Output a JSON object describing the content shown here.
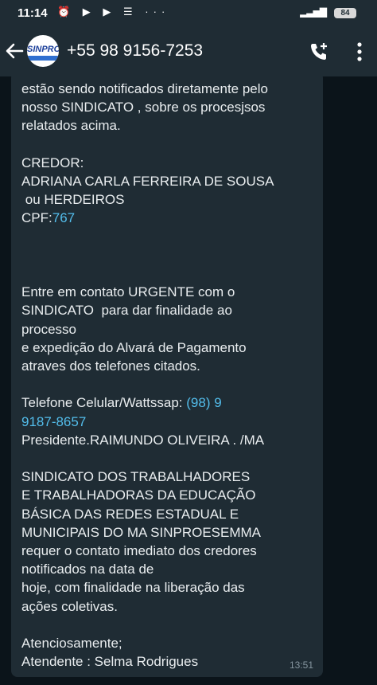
{
  "status_bar": {
    "time": "11:14",
    "indicators": "⏰ ▶ ▶ ☰ ···",
    "battery": "84"
  },
  "header": {
    "contact_title": "+55 98 9156-7253",
    "avatar_text": "SINPRO"
  },
  "message": {
    "lines": [
      "estão sendo notificados diretamente pelo",
      "nosso SINDICATO , sobre os procesjsos",
      "relatados acima.",
      "",
      "CREDOR:",
      "ADRIANA CARLA FERREIRA DE SOUSA",
      " ou HERDEIROS"
    ],
    "cpf_label": "CPF:",
    "cpf_value": "767",
    "lines2": [
      "",
      "",
      "",
      "Entre em contato URGENTE com o",
      "SINDICATO  para dar finalidade ao",
      "processo",
      "e expedição do Alvará de Pagamento",
      "atraves dos telefones citados.",
      ""
    ],
    "phone_label": "Telefone Celular/Wattssap: ",
    "phone_part1": "(98) 9",
    "phone_part2": "9187-8657",
    "lines3": [
      "Presidente.RAIMUNDO OLIVEIRA . /MA",
      "",
      "SINDICATO DOS TRABALHADORES",
      "E TRABALHADORAS DA EDUCAÇÃO",
      "BÁSICA DAS REDES ESTADUAL E",
      "MUNICIPAIS DO MA SINPROESEMMA",
      "requer o contato imediato dos credores",
      "notificados na data de",
      "hoje, com finalidade na liberação das",
      "ações coletivas.",
      "",
      "Atenciosamente;",
      "Atendente : Selma Rodrigues"
    ],
    "time": "13:51"
  },
  "colors": {
    "background": "#0b141a",
    "bubble": "#1f2c34",
    "link": "#53bdeb"
  }
}
